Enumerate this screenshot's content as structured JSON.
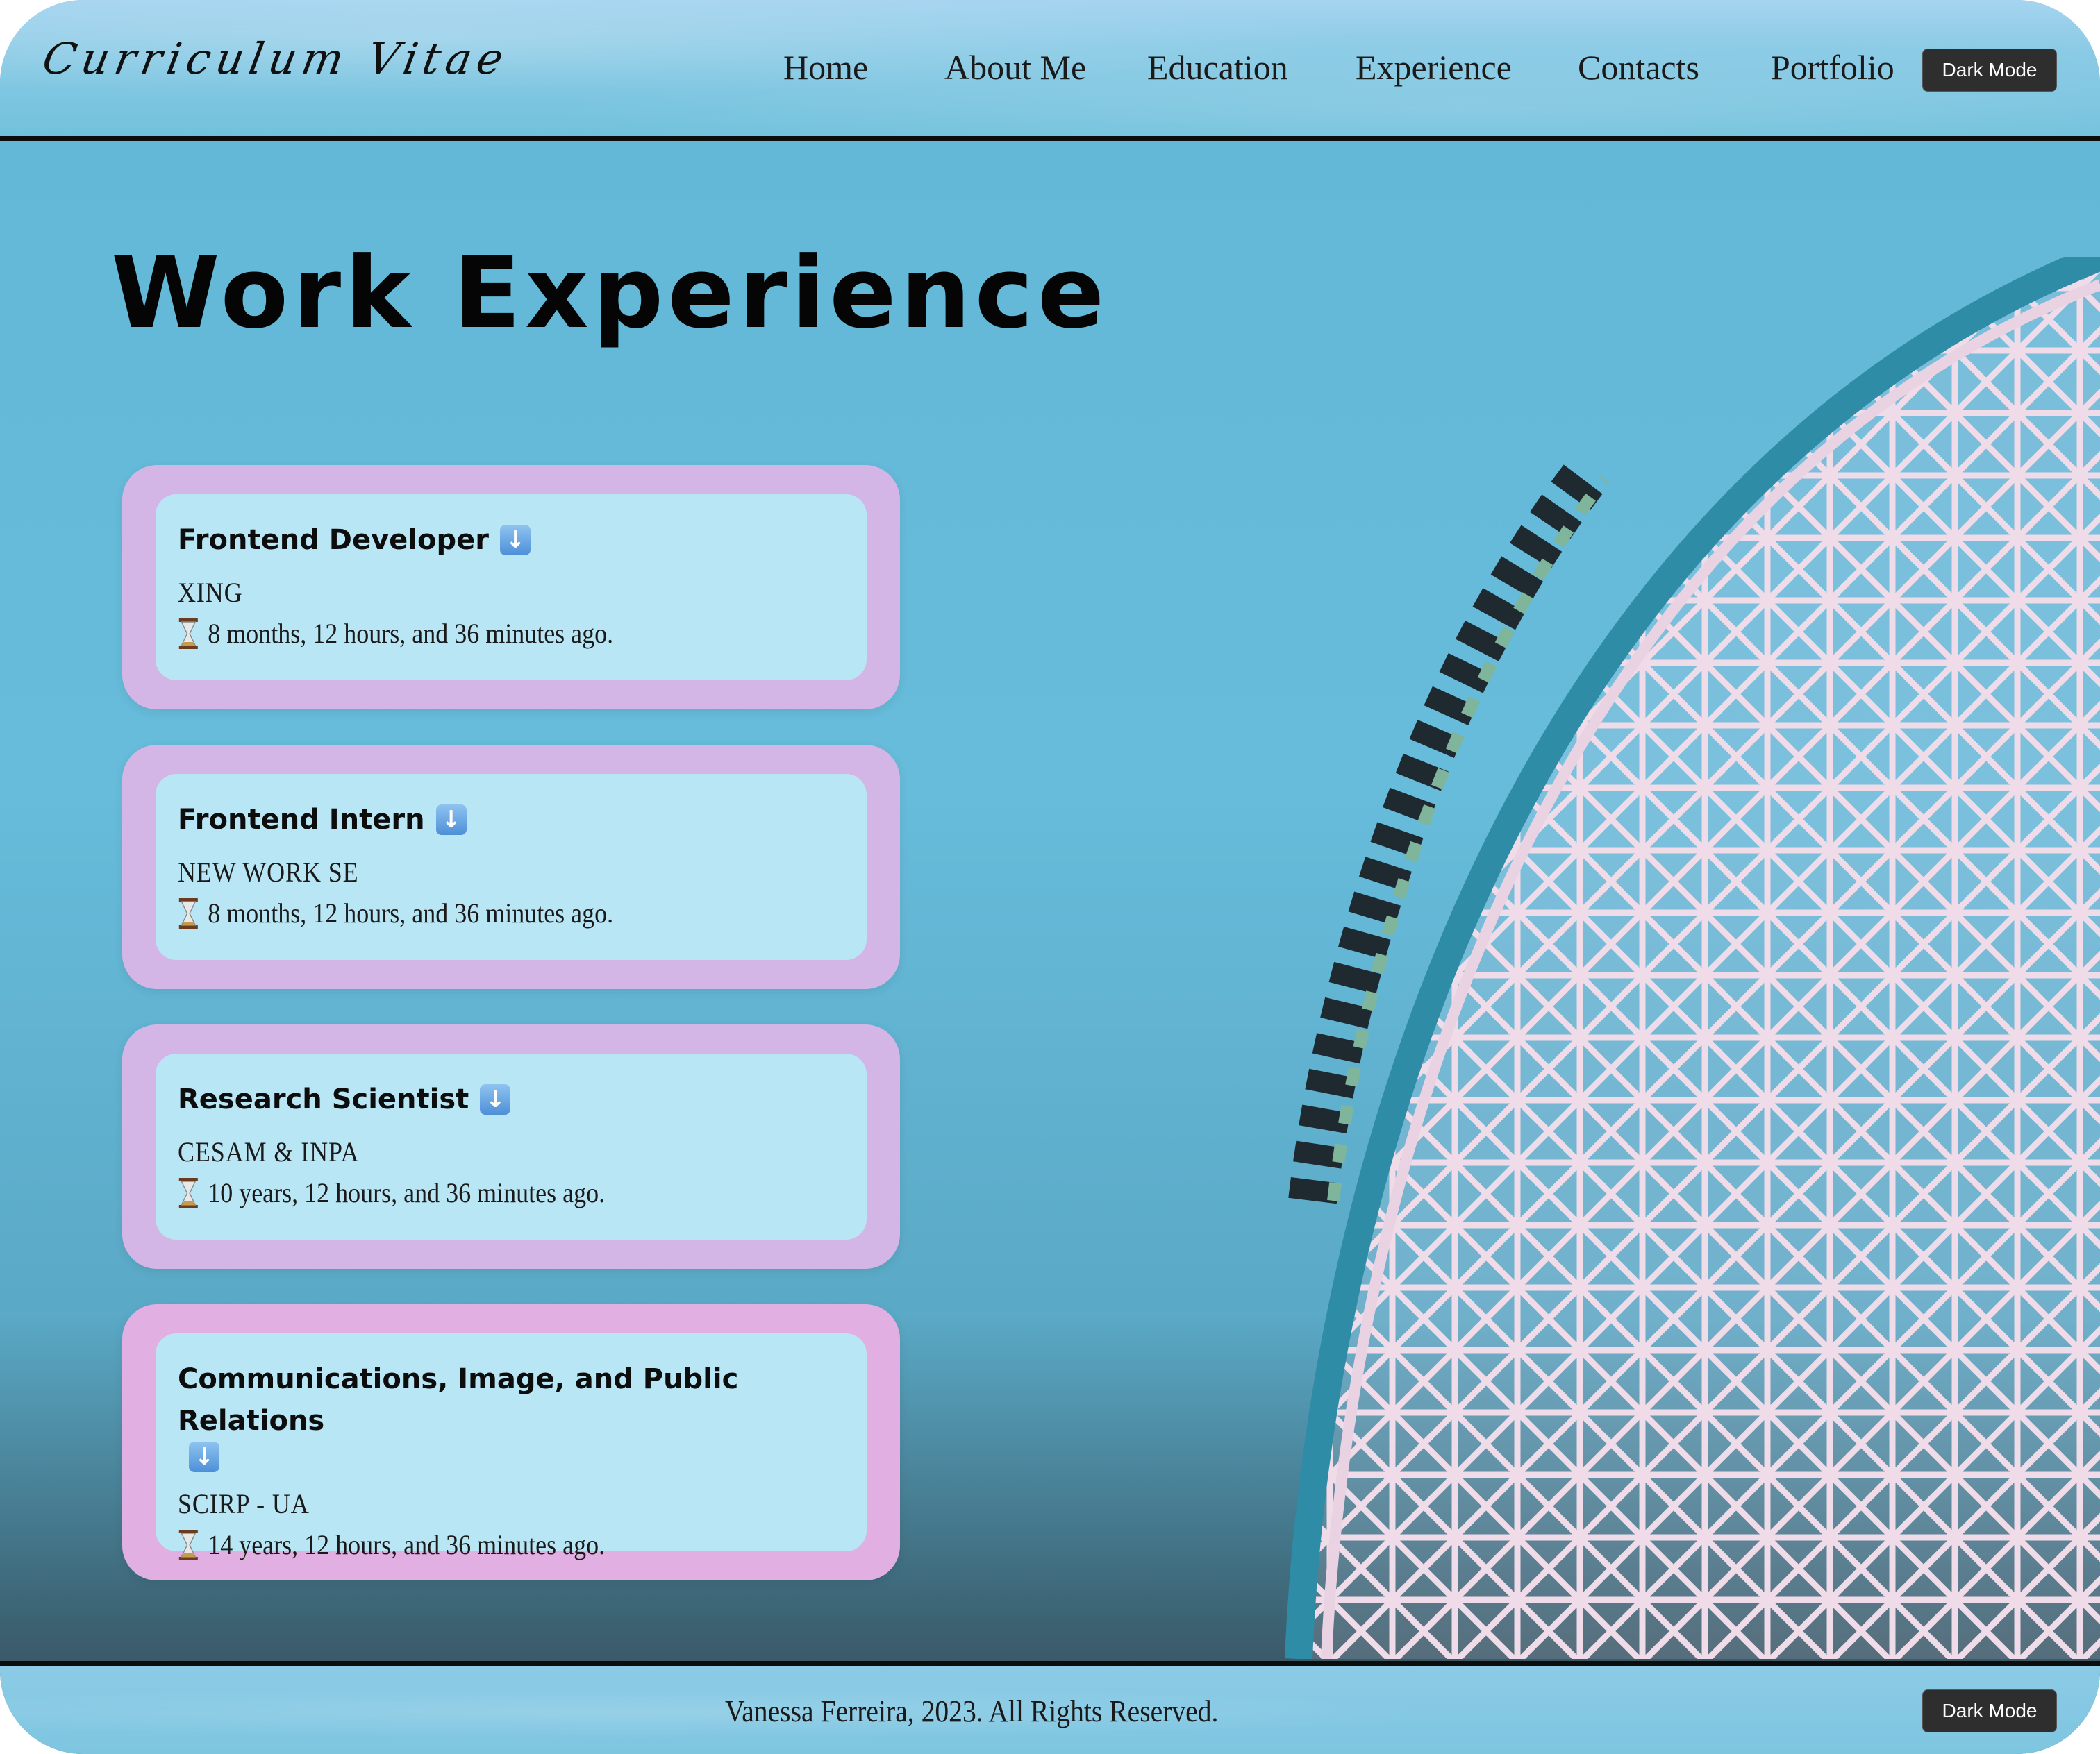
{
  "header": {
    "logo": "Curriculum Vitae",
    "nav": [
      "Home",
      "About Me",
      "Education",
      "Experience",
      "Contacts",
      "Portfolio"
    ],
    "dark_mode_label": "Dark Mode"
  },
  "main": {
    "title": "Work Experience",
    "jobs": [
      {
        "role": "Frontend Developer",
        "company": "XING",
        "duration": "8 months, 12 hours, and 36 minutes ago."
      },
      {
        "role": "Frontend Intern",
        "company": "NEW WORK SE",
        "duration": "8 months, 12 hours, and 36 minutes ago."
      },
      {
        "role": "Research Scientist",
        "company": "CESAM & INPA",
        "duration": "10 years, 12 hours, and 36 minutes ago."
      },
      {
        "role": "Communications, Image, and Public Relations",
        "company": "SCIRP - UA",
        "duration": "14 years, 12 hours, and 36 minutes ago."
      }
    ]
  },
  "footer": {
    "copyright": "Vanessa Ferreira, 2023. All Rights Reserved.",
    "dark_mode_label": "Dark Mode"
  },
  "icons": {
    "expand": "down-arrow-icon",
    "time": "hourglass-icon"
  },
  "colors": {
    "card_outer": "#d4b6e6",
    "card_inner": "#b9e6f5",
    "button": "#2e2e2e"
  }
}
